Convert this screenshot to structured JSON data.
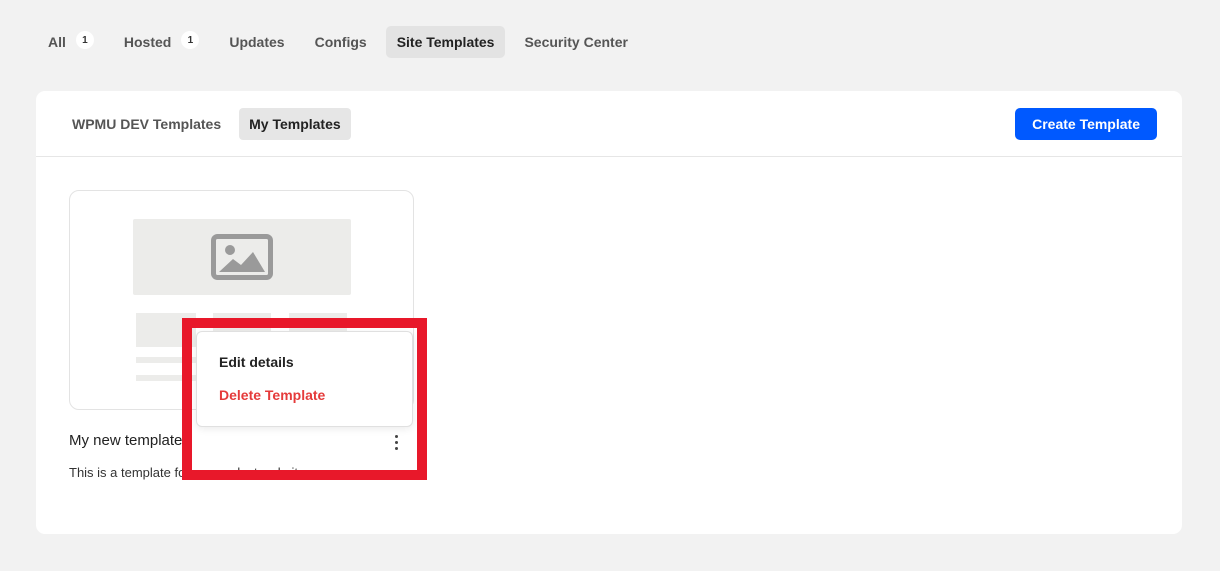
{
  "top_tabs": [
    {
      "label": "All",
      "count": "1"
    },
    {
      "label": "Hosted",
      "count": "1"
    },
    {
      "label": "Updates"
    },
    {
      "label": "Configs"
    },
    {
      "label": "Site Templates",
      "active": true
    },
    {
      "label": "Security Center"
    }
  ],
  "sub_tabs": [
    {
      "label": "WPMU DEV Templates"
    },
    {
      "label": "My Templates",
      "active": true
    }
  ],
  "create_button_label": "Create Template",
  "template": {
    "title": "My new template",
    "description": "This is a template for my product website"
  },
  "menu": {
    "edit_label": "Edit details",
    "delete_label": "Delete Template"
  },
  "colors": {
    "accent": "#0059ff",
    "danger": "#e53b3b",
    "highlight": "#e8182a"
  },
  "icons": {
    "thumbnail": "image-placeholder-icon",
    "menu": "kebab-menu-icon"
  }
}
